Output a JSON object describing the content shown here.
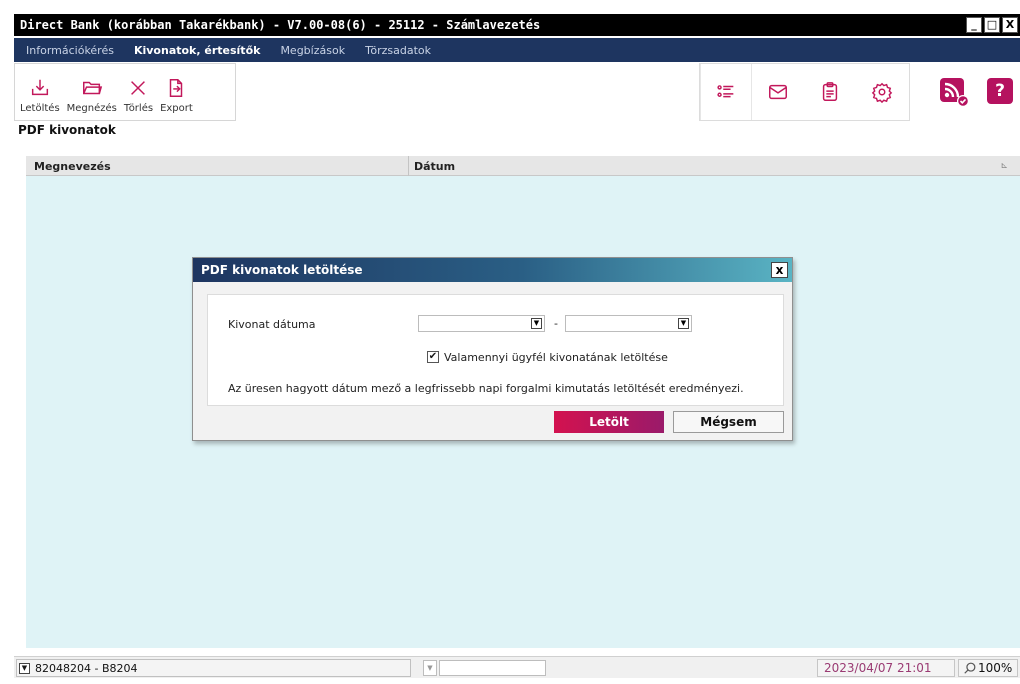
{
  "window": {
    "title": "Direct Bank (korábban Takarékbank) - V7.00-08(6) - 25112 - Számlavezetés",
    "buttons": [
      "_",
      "□",
      "X"
    ]
  },
  "menu": {
    "items": [
      {
        "label": "Információkérés",
        "active": false
      },
      {
        "label": "Kivonatok, értesítők",
        "active": true
      },
      {
        "label": "Megbízások",
        "active": false
      },
      {
        "label": "Törzsadatok",
        "active": false
      }
    ]
  },
  "toolbar": {
    "download": "Letöltés",
    "view": "Megnézés",
    "delete": "Törlés",
    "export": "Export"
  },
  "right_toolbar": {
    "icons": [
      "list-icon",
      "mail-icon",
      "clipboard-icon",
      "settings-icon"
    ]
  },
  "help": {
    "label": "?"
  },
  "section": {
    "title": "PDF kivonatok"
  },
  "grid": {
    "columns": [
      "Megnevezés",
      "Dátum"
    ],
    "rows": []
  },
  "dialog": {
    "title": "PDF kivonatok letöltése",
    "close_label": "x",
    "date_label": "Kivonat dátuma",
    "date_from": "",
    "date_separator": "-",
    "date_to": "",
    "checkbox_label": "Valamennyi ügyfél kivonatának letöltése",
    "checkbox_checked": "✔",
    "info_text": "Az üresen hagyott dátum mező a legfrissebb napi forgalmi kimutatás letöltését eredményezi.",
    "primary_button": "Letölt",
    "secondary_button": "Mégsem"
  },
  "statusbar": {
    "account": "82048204 - B8204",
    "datetime": "2023/04/07 21:01",
    "zoom": "100%"
  },
  "colors": {
    "menubar": "#1e3560",
    "accent": "#b5125f",
    "grid_bg": "#dff3f6"
  }
}
